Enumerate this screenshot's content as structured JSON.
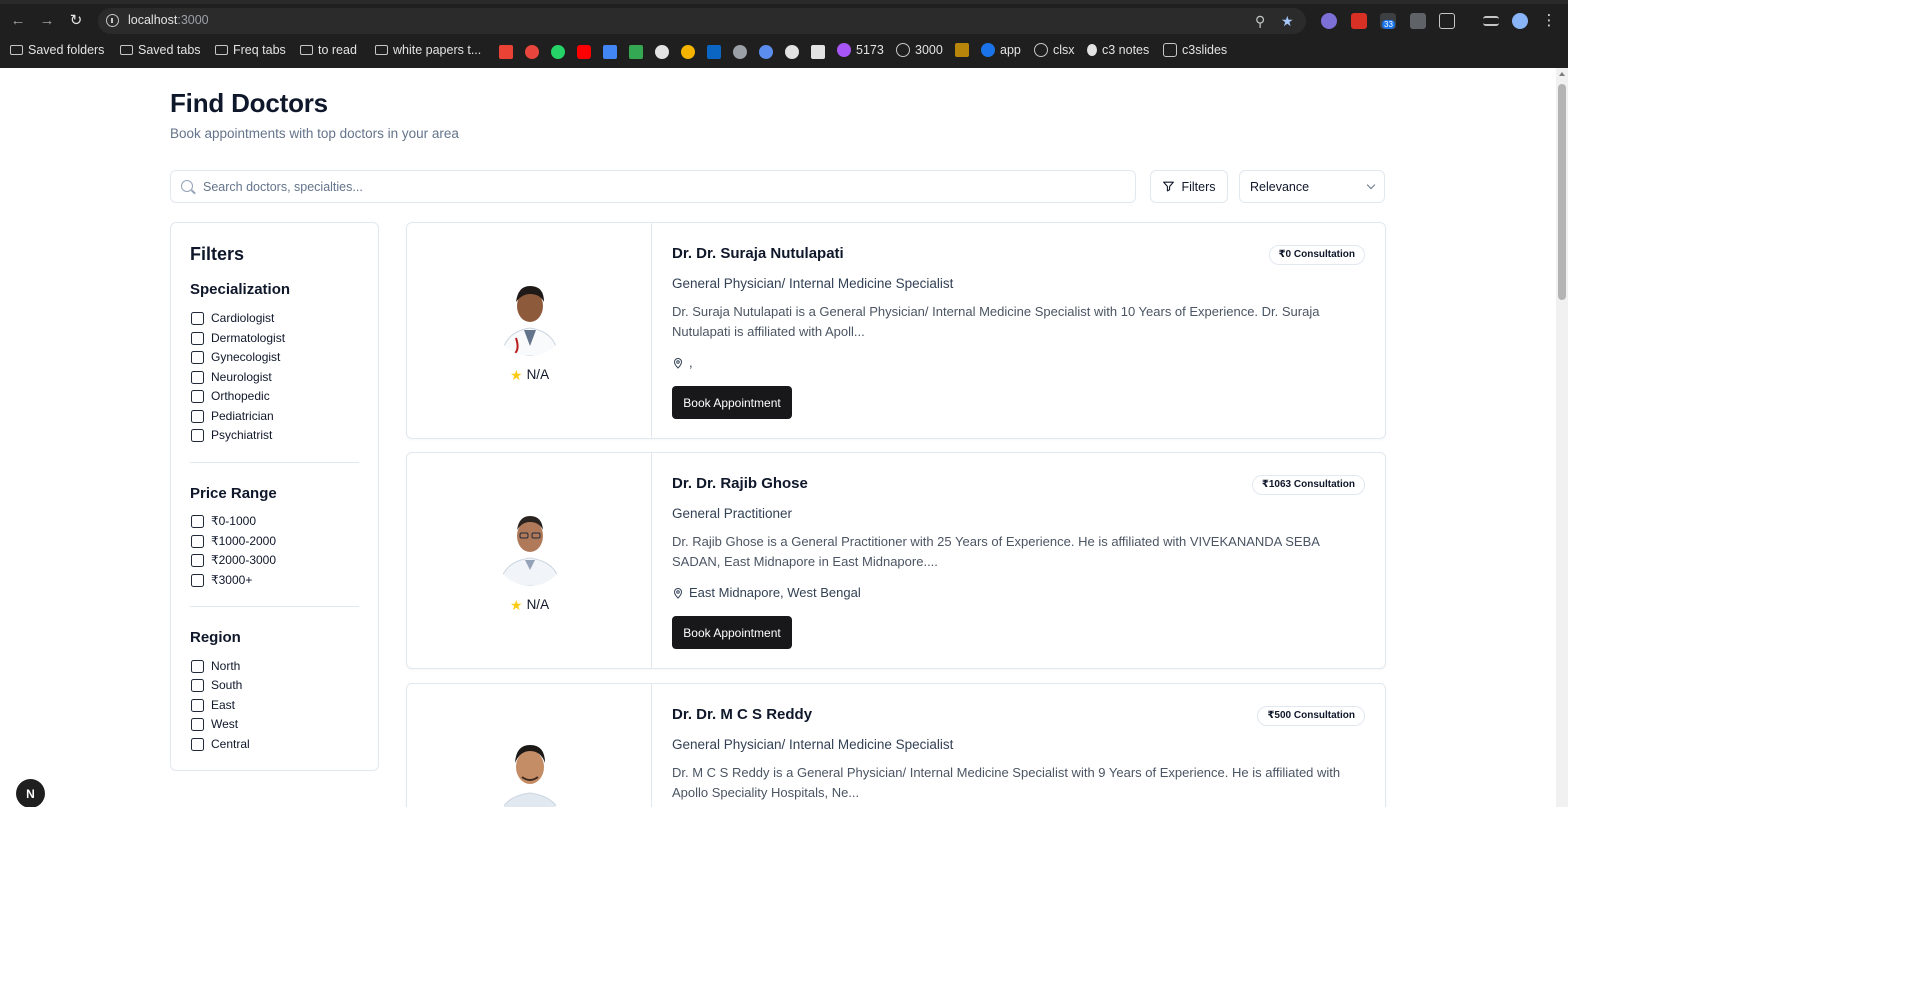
{
  "browser": {
    "url_host": "localhost",
    "url_port": ":3000",
    "bookmarks": [
      {
        "label": "Saved folders",
        "type": "folder"
      },
      {
        "label": "Saved tabs",
        "type": "folder"
      },
      {
        "label": "Freq tabs",
        "type": "folder"
      },
      {
        "label": "to read",
        "type": "folder"
      },
      {
        "label": "white papers t...",
        "type": "folder"
      },
      {
        "label": "5173",
        "type": "site"
      },
      {
        "label": "3000",
        "type": "site"
      },
      {
        "label": "app",
        "type": "site"
      },
      {
        "label": "clsx",
        "type": "site"
      },
      {
        "label": "c3 notes",
        "type": "site"
      },
      {
        "label": "c3slides",
        "type": "site"
      }
    ],
    "extension_badge": "33"
  },
  "header": {
    "title": "Find Doctors",
    "subtitle": "Book appointments with top doctors in your area"
  },
  "search": {
    "placeholder": "Search doctors, specialties...",
    "filters_label": "Filters",
    "sort_value": "Relevance"
  },
  "sidebar": {
    "title": "Filters",
    "specialization": {
      "heading": "Specialization",
      "options": [
        "Cardiologist",
        "Dermatologist",
        "Gynecologist",
        "Neurologist",
        "Orthopedic",
        "Pediatrician",
        "Psychiatrist"
      ]
    },
    "price": {
      "heading": "Price Range",
      "options": [
        "₹0-1000",
        "₹1000-2000",
        "₹2000-3000",
        "₹3000+"
      ]
    },
    "region": {
      "heading": "Region",
      "options": [
        "North",
        "South",
        "East",
        "West",
        "Central"
      ]
    }
  },
  "doctors": [
    {
      "name": "Dr. Dr. Suraja Nutulapati",
      "fee": "₹0 Consultation",
      "specialty": "General Physician/ Internal Medicine Specialist",
      "description": "Dr. Suraja Nutulapati is a General Physician/ Internal Medicine Specialist with 10 Years of Experience. Dr. Suraja Nutulapati is affiliated with Apoll...",
      "location": ",",
      "rating": "N/A",
      "book_label": "Book Appointment"
    },
    {
      "name": "Dr. Dr. Rajib Ghose",
      "fee": "₹1063 Consultation",
      "specialty": "General Practitioner",
      "description": "Dr. Rajib Ghose is a General Practitioner with 25 Years of Experience. He is affiliated with VIVEKANANDA SEBA SADAN, East Midnapore in East Midnapore....",
      "location": "East Midnapore, West Bengal",
      "rating": "N/A",
      "book_label": "Book Appointment"
    },
    {
      "name": "Dr. Dr. M C S Reddy",
      "fee": "₹500 Consultation",
      "specialty": "General Physician/ Internal Medicine Specialist",
      "description": "Dr. M C S Reddy is a General Physician/ Internal Medicine Specialist with 9 Years of Experience. He is affiliated with Apollo Speciality Hospitals, Ne...",
      "location": "",
      "rating": "",
      "book_label": ""
    }
  ],
  "dev_badge": "N",
  "colors": {
    "primary_button": "#18181b",
    "star": "#facc15",
    "border": "#e2e8f0",
    "muted_text": "#64748b"
  }
}
